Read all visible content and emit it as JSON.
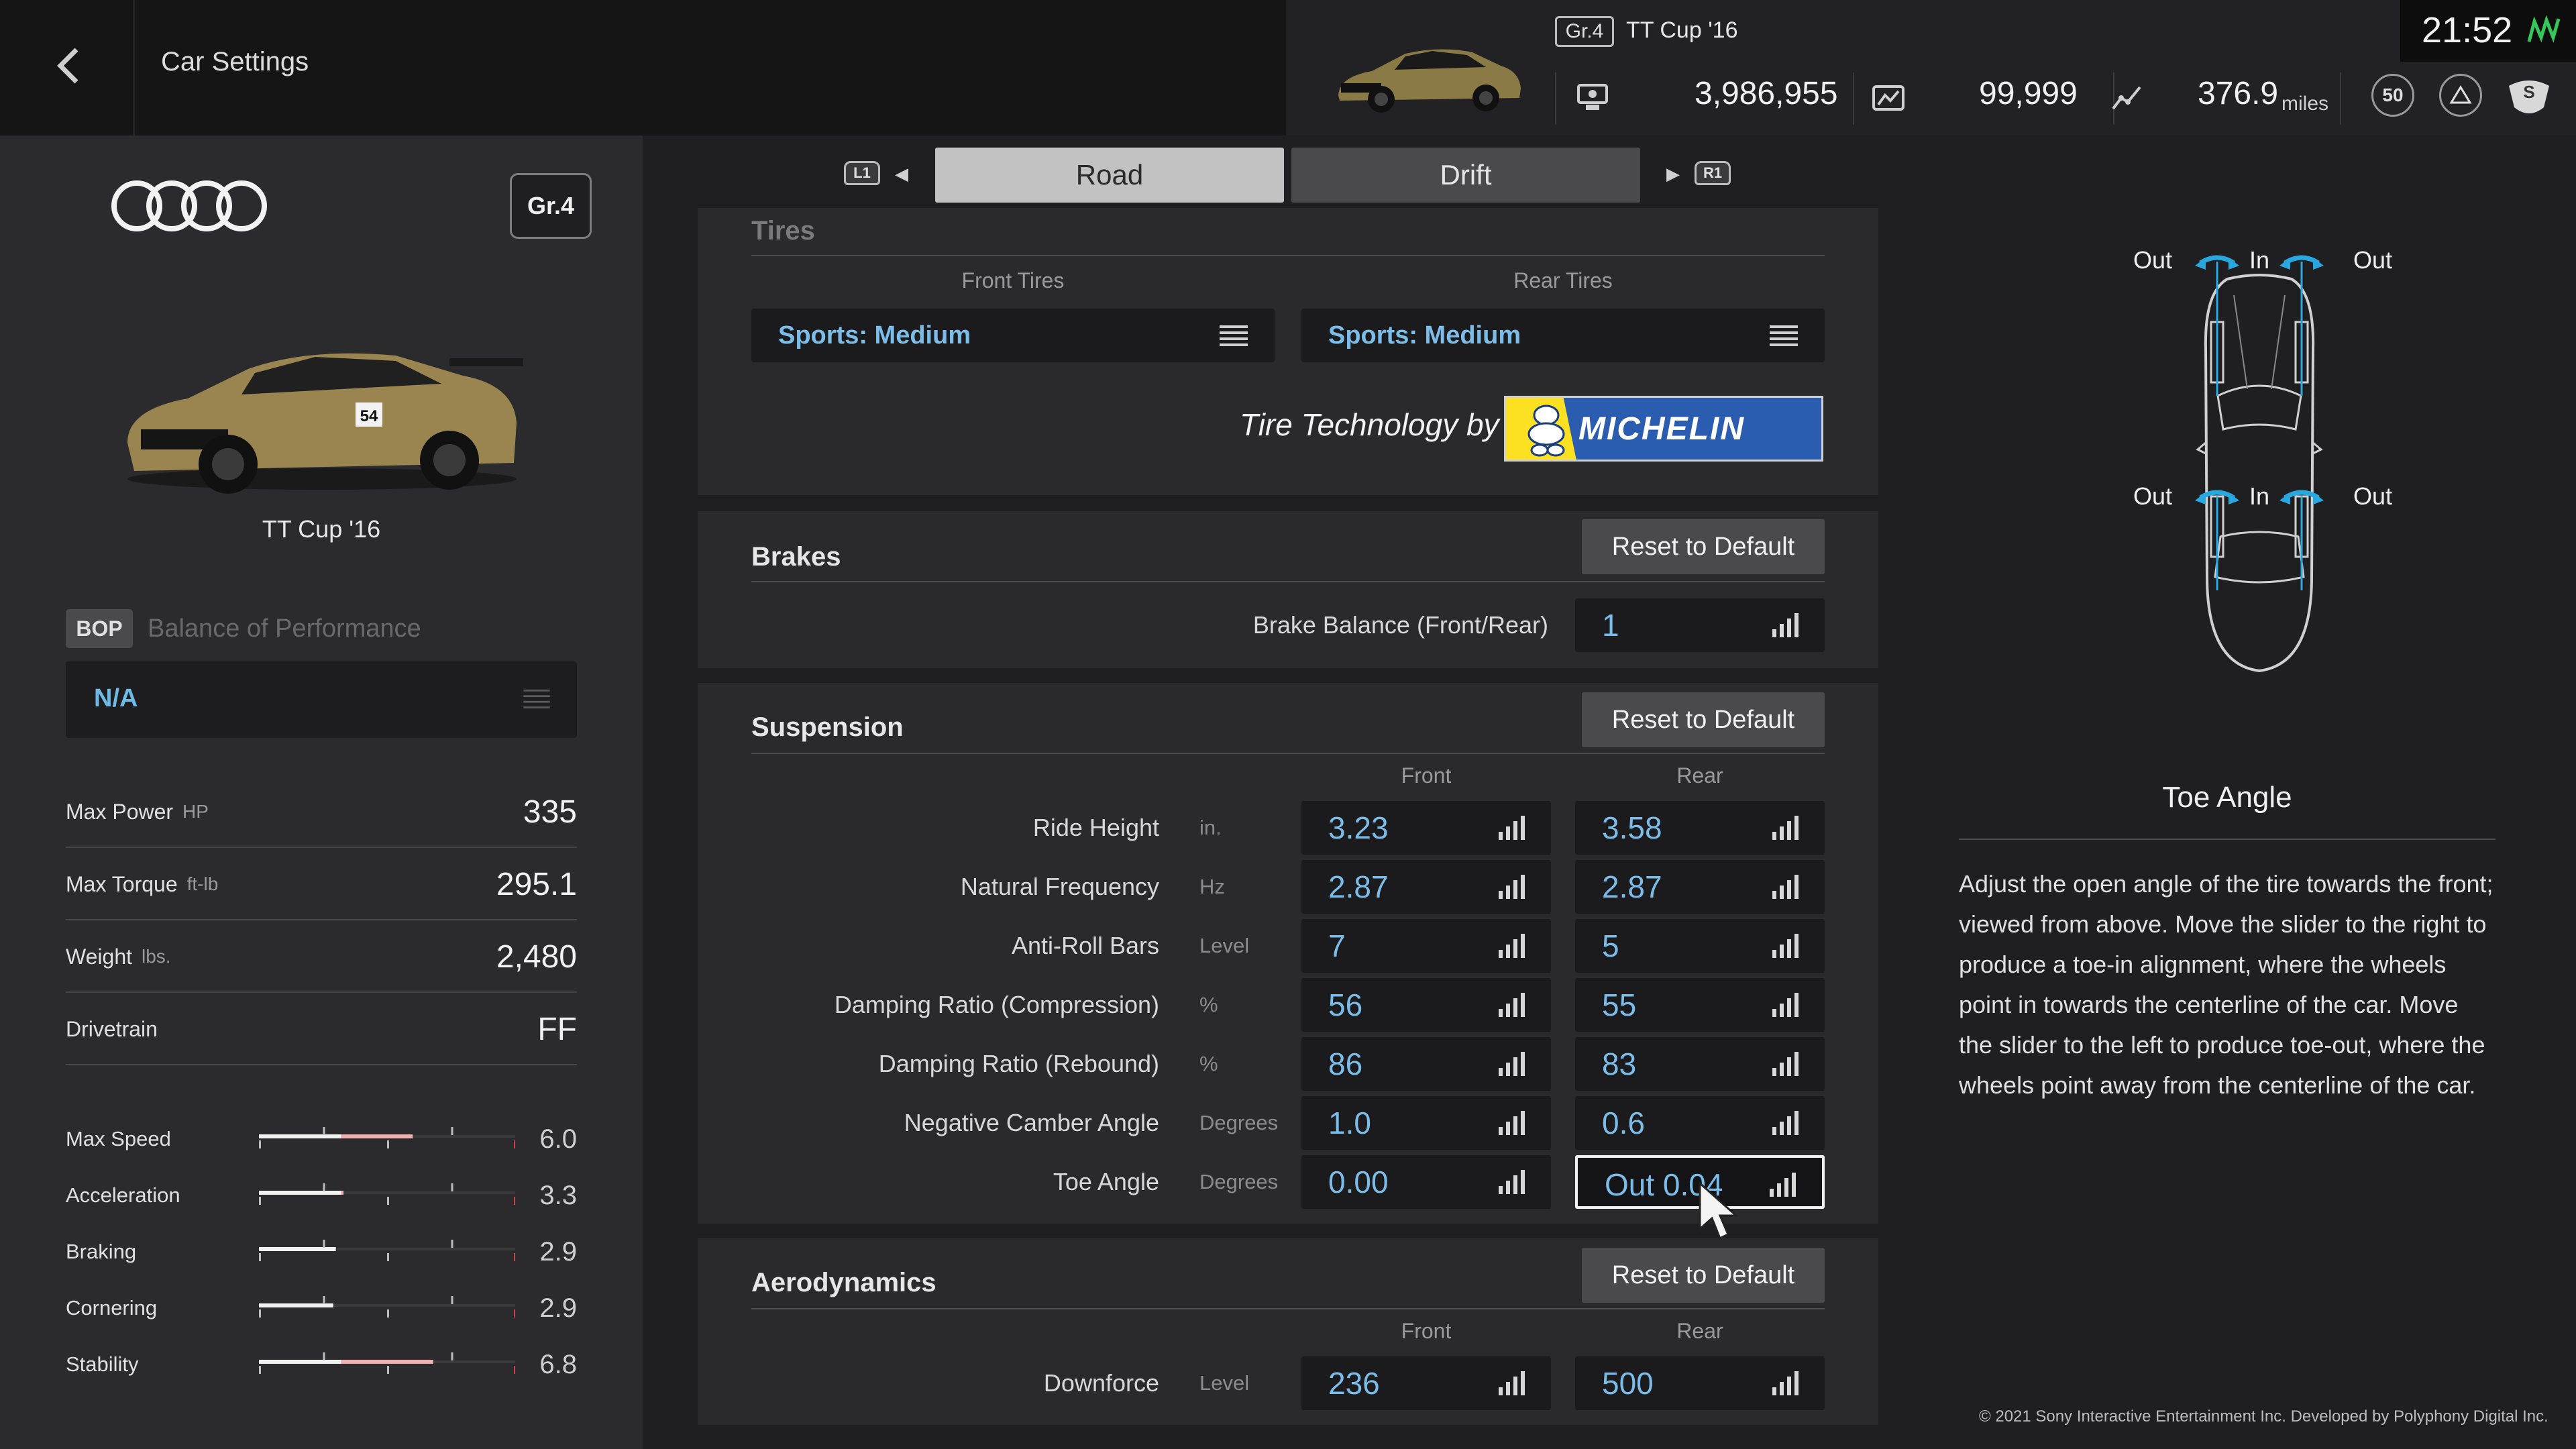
{
  "header": {
    "title": "Car Settings",
    "car_class": "Gr.4",
    "car_name": "TT Cup '16",
    "credits": "3,986,955",
    "mileage_points": "99,999",
    "distance": "376.9",
    "distance_unit": "miles",
    "level": "50",
    "clock": "21:52"
  },
  "car": {
    "brand_icon": "audi-rings-logo",
    "class_badge": "Gr.4",
    "name": "TT Cup '16",
    "bop_badge": "BOP",
    "bop_label": "Balance of Performance",
    "bop_value": "N/A"
  },
  "specs": [
    {
      "label": "Max Power",
      "unit": "HP",
      "value": "335"
    },
    {
      "label": "Max Torque",
      "unit": "ft-lb",
      "value": "295.1"
    },
    {
      "label": "Weight",
      "unit": "lbs.",
      "value": "2,480"
    },
    {
      "label": "Drivetrain",
      "unit": "",
      "value": "FF"
    }
  ],
  "ratings": [
    {
      "label": "Max Speed",
      "value": "6.0",
      "fraction": 0.6
    },
    {
      "label": "Acceleration",
      "value": "3.3",
      "fraction": 0.33
    },
    {
      "label": "Braking",
      "value": "2.9",
      "fraction": 0.3
    },
    {
      "label": "Cornering",
      "value": "2.9",
      "fraction": 0.29
    },
    {
      "label": "Stability",
      "value": "6.8",
      "fraction": 0.68
    }
  ],
  "tabs": {
    "left_shoulder": "L1",
    "right_shoulder": "R1",
    "road": "Road",
    "drift": "Drift"
  },
  "tires": {
    "title": "Tires",
    "front_head": "Front Tires",
    "rear_head": "Rear Tires",
    "front_value": "Sports: Medium",
    "rear_value": "Sports: Medium",
    "tech_text": "Tire Technology by",
    "brand": "MICHELIN"
  },
  "brakes": {
    "title": "Brakes",
    "reset": "Reset to Default",
    "balance_label": "Brake Balance (Front/Rear)",
    "balance_value": "1"
  },
  "suspension": {
    "title": "Suspension",
    "reset": "Reset to Default",
    "front_head": "Front",
    "rear_head": "Rear",
    "rows": [
      {
        "label": "Ride Height",
        "unit": "in.",
        "front": "3.23",
        "rear": "3.58"
      },
      {
        "label": "Natural Frequency",
        "unit": "Hz",
        "front": "2.87",
        "rear": "2.87"
      },
      {
        "label": "Anti-Roll Bars",
        "unit": "Level",
        "front": "7",
        "rear": "5"
      },
      {
        "label": "Damping Ratio (Compression)",
        "unit": "%",
        "front": "56",
        "rear": "55"
      },
      {
        "label": "Damping Ratio (Rebound)",
        "unit": "%",
        "front": "86",
        "rear": "83"
      },
      {
        "label": "Negative Camber Angle",
        "unit": "Degrees",
        "front": "1.0",
        "rear": "0.6"
      },
      {
        "label": "Toe Angle",
        "unit": "Degrees",
        "front": "0.00",
        "rear": "Out 0.04"
      }
    ]
  },
  "aero": {
    "title": "Aerodynamics",
    "reset": "Reset to Default",
    "front_head": "Front",
    "rear_head": "Rear",
    "label": "Downforce",
    "unit": "Level",
    "front": "236",
    "rear": "500"
  },
  "diagram": {
    "top_left": "Out",
    "top_mid": "In",
    "top_right": "Out",
    "bottom_left": "Out",
    "bottom_mid": "In",
    "bottom_right": "Out",
    "accent": "#29a8e0"
  },
  "help": {
    "title": "Toe Angle",
    "text": "Adjust the open angle of the tire towards the front; viewed from above. Move the slider to the right to produce a toe-in alignment, where the wheels point in towards the centerline of the car. Move the slider to the left to produce toe-out, where the wheels point away from the centerline of the car."
  },
  "footer": {
    "copyright": "© 2021 Sony Interactive Entertainment Inc. Developed by Polyphony Digital Inc."
  }
}
